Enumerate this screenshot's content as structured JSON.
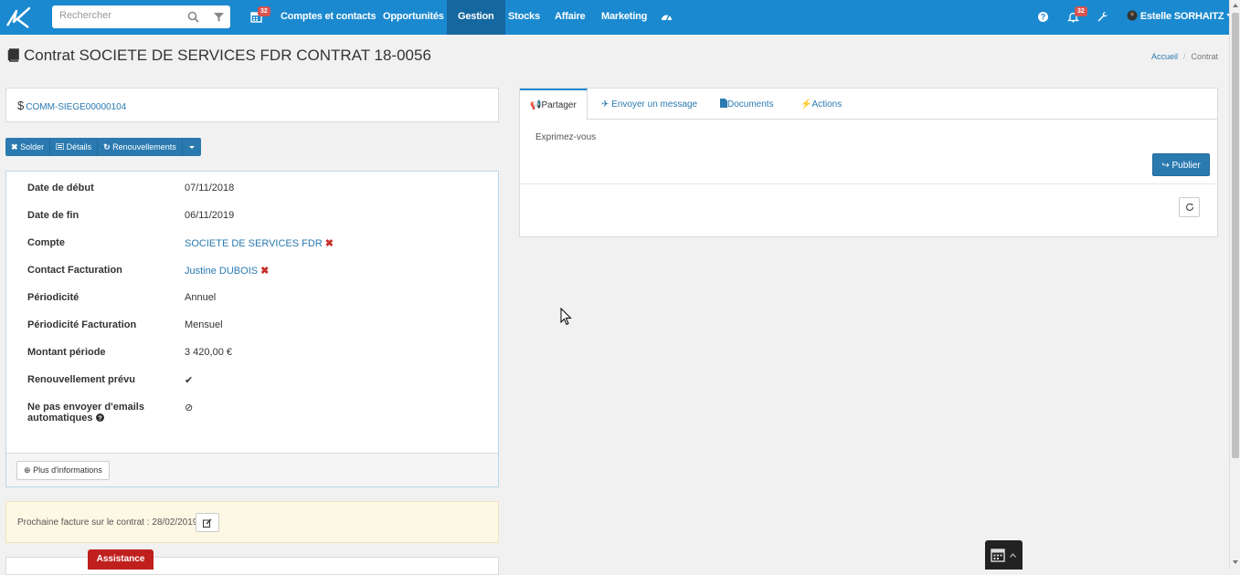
{
  "topbar": {
    "search_placeholder": "Rechercher",
    "calendar_badge": "32",
    "nav": [
      "Comptes et contacts",
      "Opportunités",
      "Gestion",
      "Stocks",
      "Affaire",
      "Marketing"
    ],
    "active_nav": "Gestion",
    "notif_badge": "32",
    "user_name": "Estelle SORHAITZ",
    "icons": [
      "calendar-icon",
      "dashboard-icon",
      "help-icon",
      "bell-icon",
      "wrench-icon"
    ]
  },
  "page": {
    "title": "Contrat SOCIETE DE SERVICES FDR CONTRAT 18-0056",
    "breadcrumb": [
      "Accueil",
      "Contrat"
    ]
  },
  "reference": "COMM-SIEGE00000104",
  "actions": {
    "solder": "Solder",
    "details": "Détails",
    "renouvellements": "Renouvellements"
  },
  "details": [
    {
      "label": "Date de début",
      "value": "07/11/2018"
    },
    {
      "label": "Date de fin",
      "value": "06/11/2019"
    },
    {
      "label": "Compte",
      "value": "SOCIETE DE SERVICES FDR",
      "link": true,
      "remove": true
    },
    {
      "label": "Contact Facturation",
      "value": "Justine DUBOIS",
      "link": true,
      "remove": true
    },
    {
      "label": "Périodicité",
      "value": "Annuel"
    },
    {
      "label": "Périodicité Facturation",
      "value": "Mensuel"
    },
    {
      "label": "Montant période",
      "value": "3 420,00 €"
    },
    {
      "label": "Renouvellement prévu",
      "value": "✔"
    },
    {
      "label": "Ne pas envoyer d'emails",
      "label2": "automatiques",
      "value": "⊘"
    }
  ],
  "more_info": "Plus d'informations",
  "next_invoice": "Prochaine facture sur le contrat : 28/02/2019",
  "assistance": "Assistance",
  "right": {
    "tabs": [
      "Partager",
      "Envoyer un message",
      "Documents",
      "Actions"
    ],
    "active_tab": "Partager",
    "share_placeholder": "Exprimez-vous",
    "publish": "Publier"
  },
  "colors": {
    "topbar": "#1a89d0",
    "active_nav": "#15679f",
    "primary_button": "#2a7ab0",
    "badge": "#d9534f",
    "assistance": "#c0201d",
    "alert_bg": "#fcf8e3"
  }
}
